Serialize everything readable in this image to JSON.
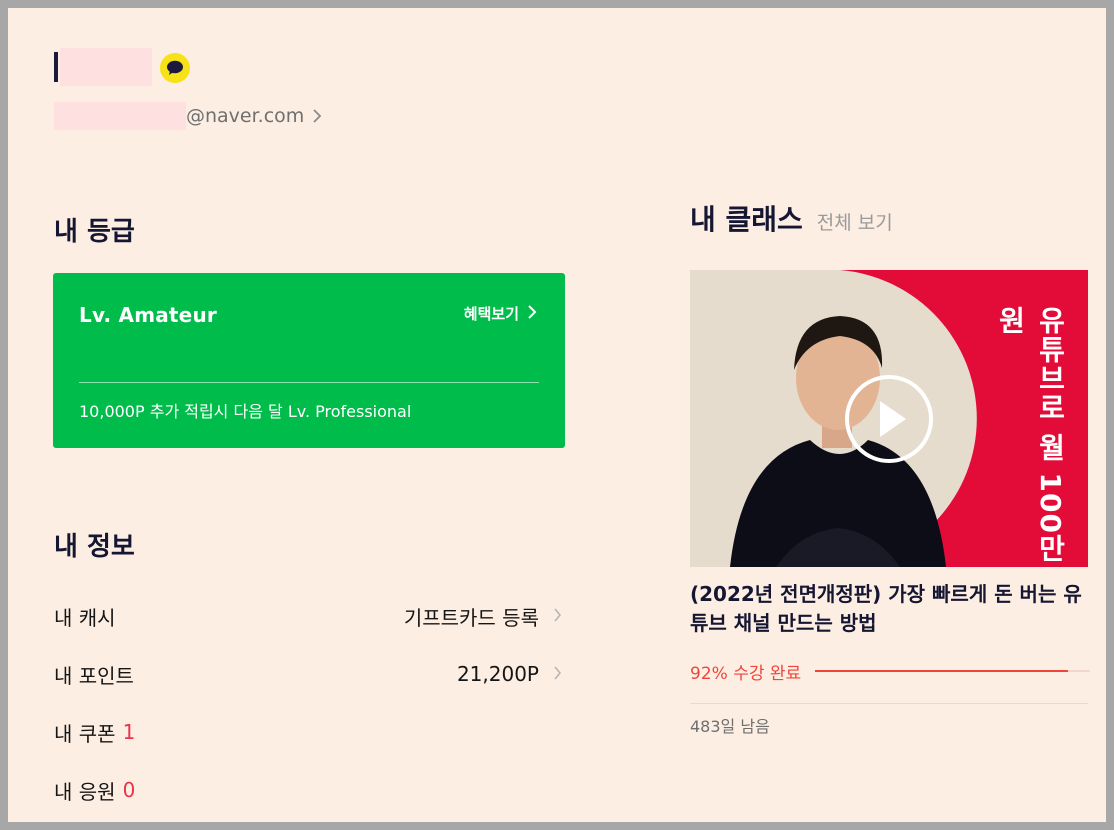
{
  "profile": {
    "email_domain": "@naver.com"
  },
  "grade": {
    "section_title": "내 등급",
    "level": "Lv. Amateur",
    "benefit_link": "혜택보기",
    "note": "10,000P 추가 적립시 다음 달 Lv. Professional",
    "card_color": "#00bc4b"
  },
  "my_info": {
    "section_title": "내 정보",
    "cash": {
      "label": "내 캐시",
      "action": "기프트카드 등록"
    },
    "points": {
      "label": "내 포인트",
      "value": "21,200P"
    },
    "coupons": {
      "label": "내 쿠폰",
      "count": "1"
    },
    "support": {
      "label": "내 응원",
      "count": "0"
    }
  },
  "my_classes": {
    "section_title": "내 클래스",
    "view_all": "전체 보기",
    "course": {
      "thumbnail_text": "유튜브로 월 100만원",
      "title": "(2022년 전면개정판) 가장 빠르게 돈 버는 유튜브 채널 만드는 방법",
      "progress_percent": 92,
      "progress_label": "92% 수강 완료",
      "days_left": "483일 남음"
    }
  },
  "colors": {
    "page_bg": "#fdeee3",
    "accent_red": "#e8354b",
    "progress_red": "#f0453a",
    "thumb_red": "#e30b37",
    "kakao_yellow": "#f7e119"
  },
  "icons": {
    "kakao": "kakao-speech-bubble-icon",
    "chevron": "chevron-right-icon",
    "play": "play-icon"
  }
}
